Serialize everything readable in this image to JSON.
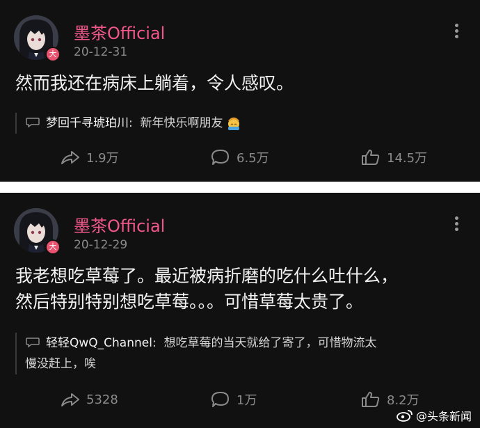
{
  "posts": [
    {
      "author": "墨茶Official",
      "badge": "大",
      "date": "20-12-31",
      "text_lines": [
        "然而我还在病床上躺着，令人感叹。"
      ],
      "comment": {
        "user": "梦回千寻琥珀川",
        "separator": ":",
        "text_lines": [
          "新年快乐啊朋友"
        ],
        "emoji": "pat-head-emoji"
      },
      "actions": {
        "repost": "1.9万",
        "comment": "6.5万",
        "like": "14.5万"
      }
    },
    {
      "author": "墨茶Official",
      "badge": "大",
      "date": "20-12-29",
      "text_lines": [
        "我老想吃草莓了。最近被病折磨的吃什么吐什么，",
        "然后特别特别想吃草莓。。。可惜草莓太贵了。"
      ],
      "comment": {
        "user": "轻轻QwQ_Channel",
        "separator": ":",
        "text_lines": [
          "想吃草莓的当天就给了寄了，可惜物流太",
          "慢没赶上，唉"
        ]
      },
      "actions": {
        "repost": "5328",
        "comment": "1万",
        "like": "8.2万"
      }
    }
  ],
  "watermark": {
    "at": "@",
    "source": "头条新闻",
    "icon": "weibo-logo-icon"
  },
  "colors": {
    "background": "#111111",
    "author": "#f0578a",
    "muted": "#8b8b8b",
    "badge": "#e8536f"
  }
}
